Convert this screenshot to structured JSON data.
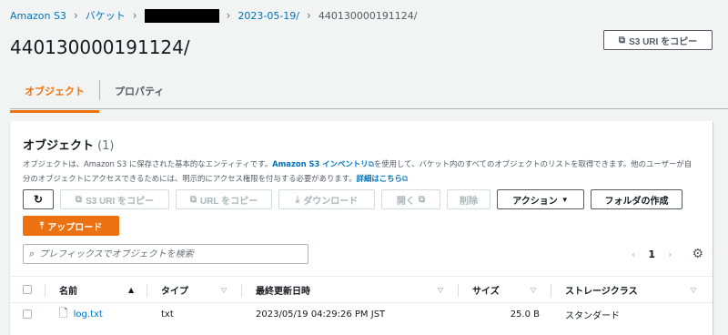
{
  "breadcrumb": {
    "items": [
      "Amazon S3",
      "バケット",
      "2023-05-19/",
      "440130000191124/"
    ]
  },
  "page": {
    "title": "440130000191124/",
    "copy_uri_label": "S3 URI をコピー"
  },
  "tabs": [
    {
      "label": "オブジェクト",
      "active": true
    },
    {
      "label": "プロパティ",
      "active": false
    }
  ],
  "panel": {
    "title": "オブジェクト",
    "count": "(1)",
    "desc_prefix": "オブジェクトは、Amazon S3 に保存された基本的なエンティティです。",
    "desc_link1": "Amazon S3 インベントリ",
    "desc_mid": "を使用して、バケット内のすべてのオブジェクトのリストを取得できます。他のユーザーが自分のオブジェクトにアクセスできるためには、明示的にアクセス権限を付与する必要があります。",
    "desc_link2": "詳細はこちら"
  },
  "toolbar": {
    "copy_s3_uri": "S3 URI をコピー",
    "copy_url": "URL をコピー",
    "download": "ダウンロード",
    "open": "開く",
    "delete": "削除",
    "actions": "アクション",
    "create_folder": "フォルダの作成",
    "upload": "アップロード"
  },
  "search": {
    "placeholder": "プレフィックスでオブジェクトを検索"
  },
  "pager": {
    "page": "1"
  },
  "table": {
    "headers": [
      "名前",
      "タイプ",
      "最終更新日時",
      "サイズ",
      "ストレージクラス"
    ],
    "rows": [
      {
        "name": "log.txt",
        "type": "txt",
        "modified": "2023/05/19 04:29:26 PM JST",
        "size": "25.0 B",
        "storage": "スタンダード"
      }
    ]
  },
  "colors": {
    "accent": "#ec7211",
    "link": "#0073bb"
  }
}
